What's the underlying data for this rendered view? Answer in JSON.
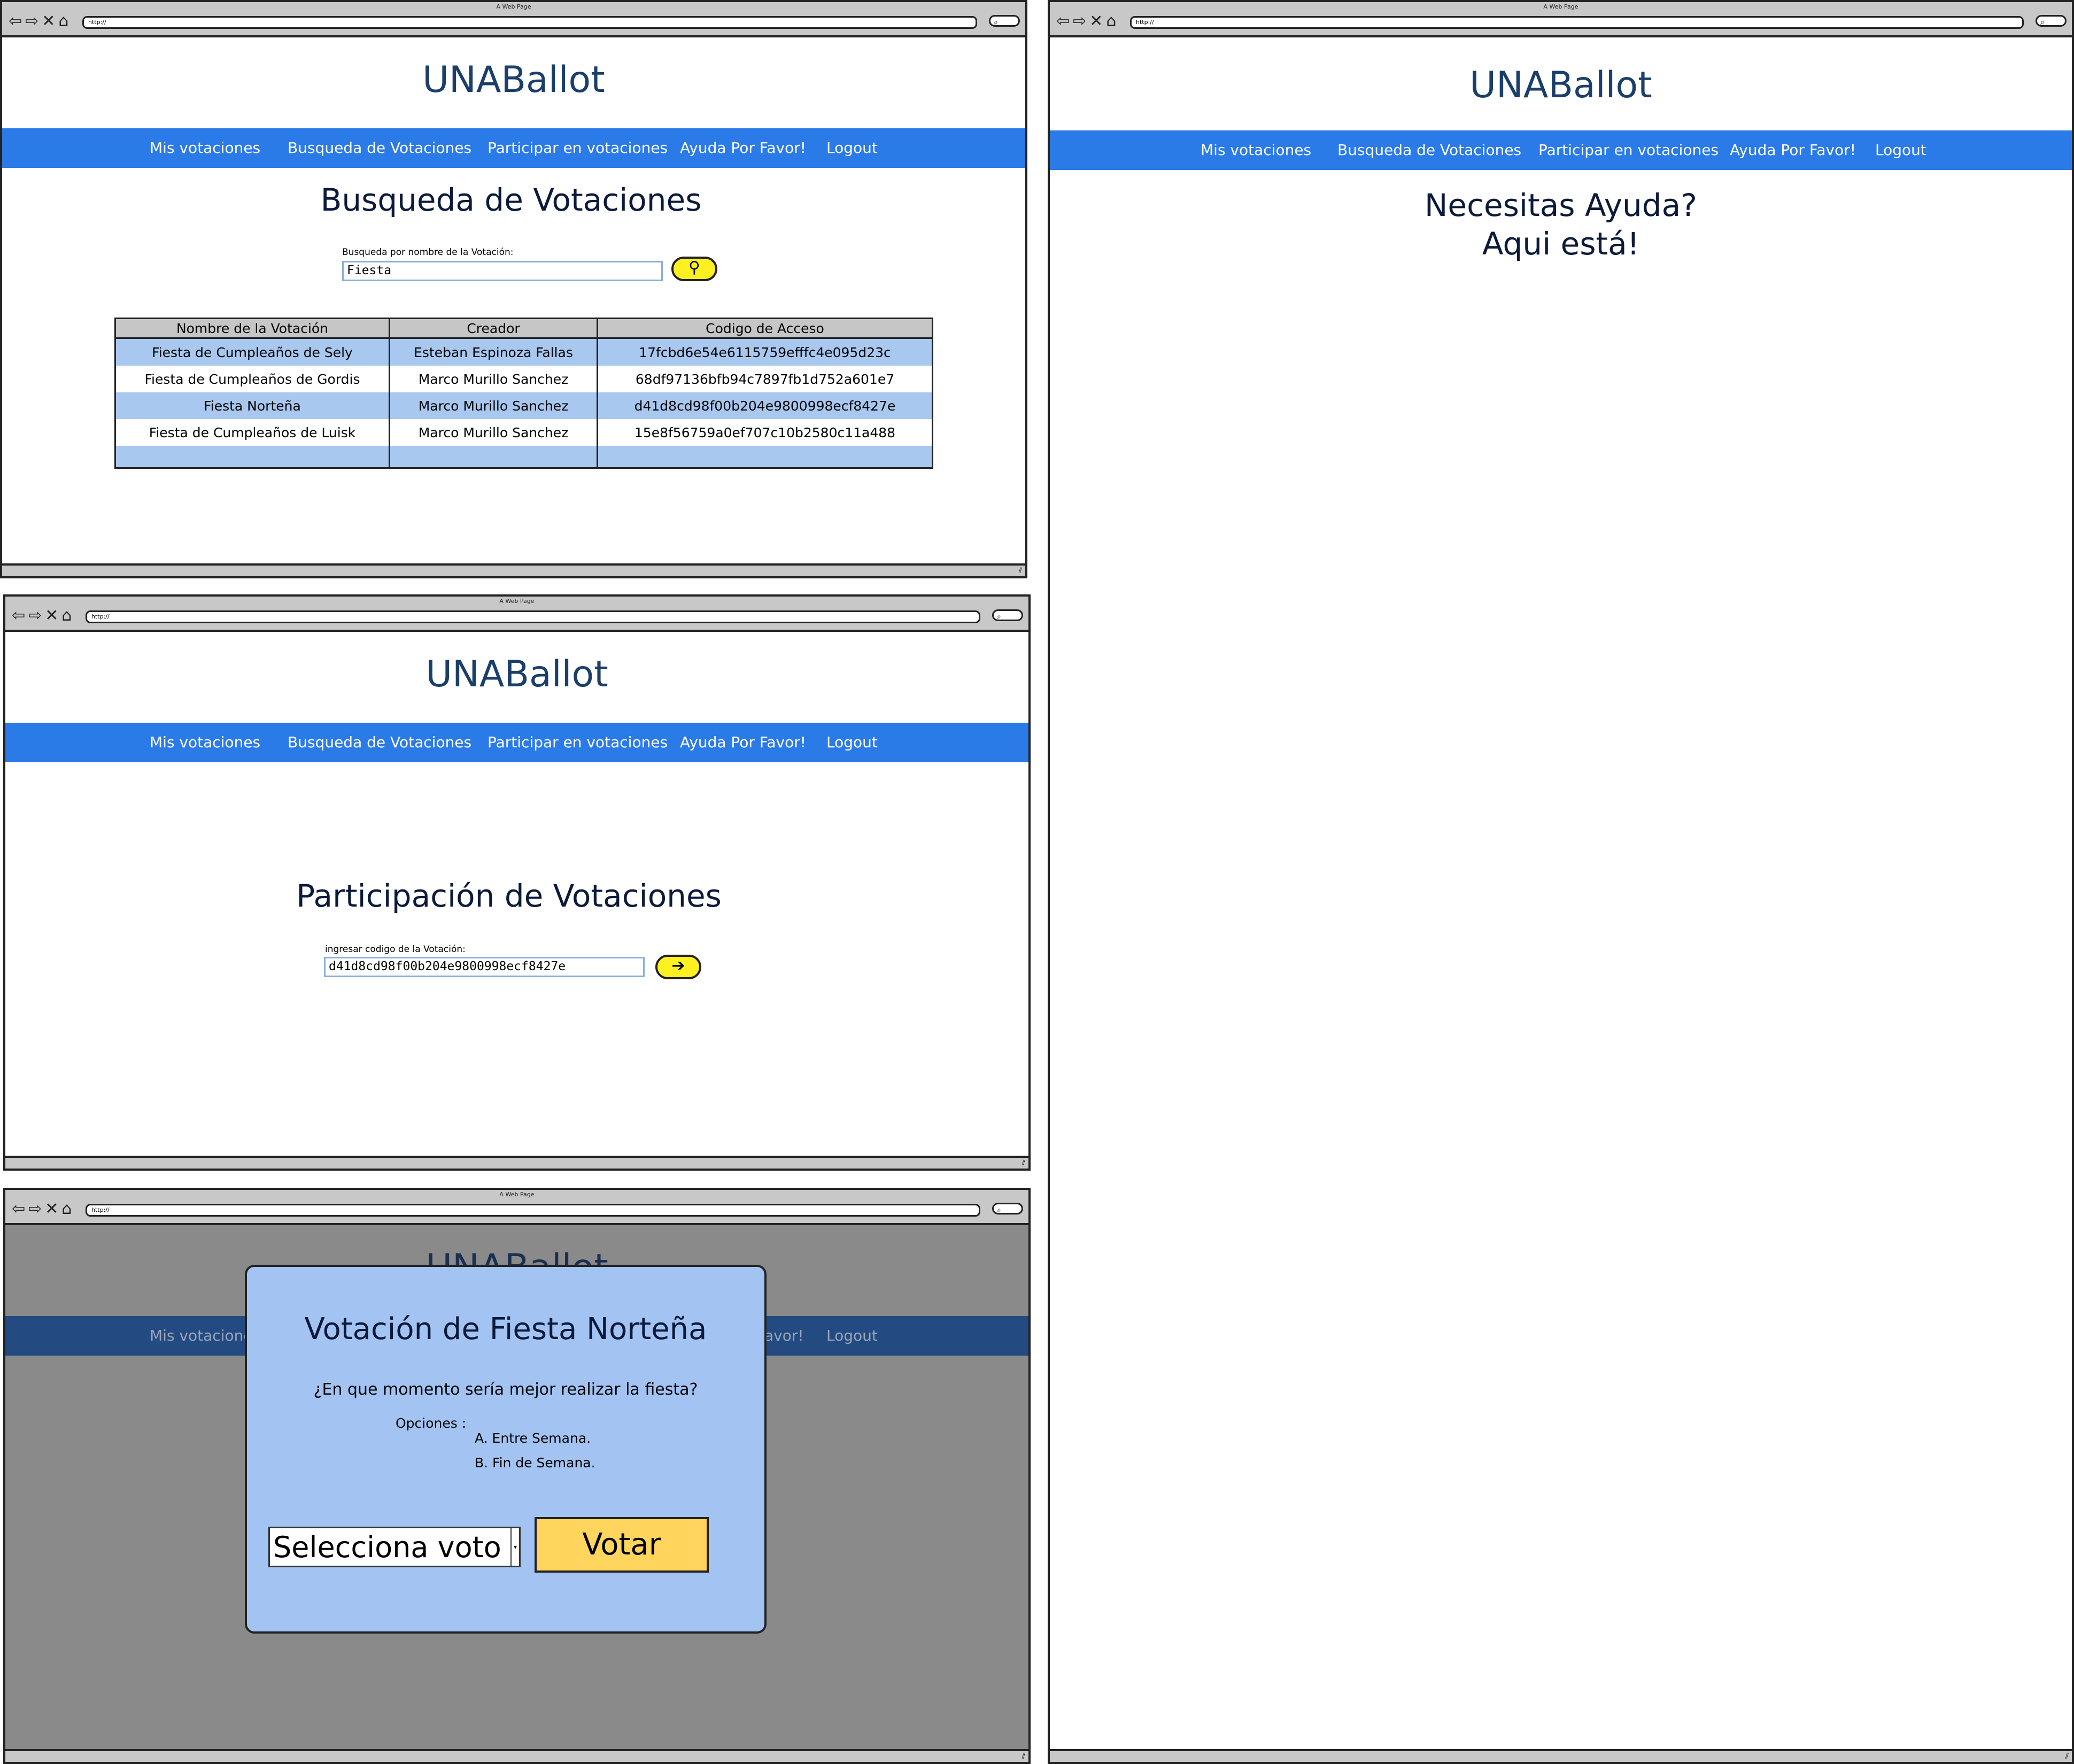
{
  "browser": {
    "window_title": "A Web Page",
    "url": "http://",
    "search_glyph": "⌕"
  },
  "app": {
    "logo": "UNABallot",
    "nav": [
      "Mis votaciones",
      "Busqueda de Votaciones",
      "Participar en votaciones",
      "Ayuda Por Favor!",
      "Logout"
    ]
  },
  "search_page": {
    "title": "Busqueda de Votaciones",
    "field_label": "Busqueda por nombre de la Votación:",
    "field_value": "Fiesta",
    "table": {
      "headers": [
        "Nombre de la Votación",
        "Creador",
        "Codigo de Acceso"
      ],
      "rows": [
        [
          "Fiesta de Cumpleaños de Sely",
          "Esteban Espinoza Fallas",
          "17fcbd6e54e6115759efffc4e095d23c"
        ],
        [
          "Fiesta de Cumpleaños de Gordis",
          "Marco Murillo Sanchez",
          "68df97136bfb94c7897fb1d752a601e7"
        ],
        [
          "Fiesta Norteña",
          "Marco Murillo Sanchez",
          "d41d8cd98f00b204e9800998ecf8427e"
        ],
        [
          "Fiesta de Cumpleaños de Luisk",
          "Marco Murillo Sanchez",
          "15e8f56759a0ef707c10b2580c11a488"
        ]
      ]
    }
  },
  "participate_page": {
    "title": "Participación de Votaciones",
    "field_label": "ingresar codigo de la Votación:",
    "field_value": "d41d8cd98f00b204e9800998ecf8427e"
  },
  "vote_modal": {
    "background_logo_fragment": "UNABallot",
    "background_nav_left": "Mis votacione",
    "background_nav_mid": "avor!",
    "background_nav_right": "Logout",
    "title": "Votación de Fiesta Norteña",
    "question": "¿En que momento sería mejor realizar la fiesta?",
    "options_label": "Opciones :",
    "options": [
      "A. Entre Semana.",
      "B. Fin de Semana."
    ],
    "select_value": "Selecciona voto",
    "submit_label": "Votar"
  },
  "help_page": {
    "title_line1": "Necesitas Ayuda?",
    "title_line2": "Aqui está!"
  },
  "colors": {
    "nav_blue": "#2a7ae8",
    "logo_navy": "#1b3f6a",
    "row_blue": "#a8c8f0",
    "button_yellow": "#fff021",
    "modal_blue": "#a3c4f3",
    "vote_button": "#ffd55e"
  }
}
